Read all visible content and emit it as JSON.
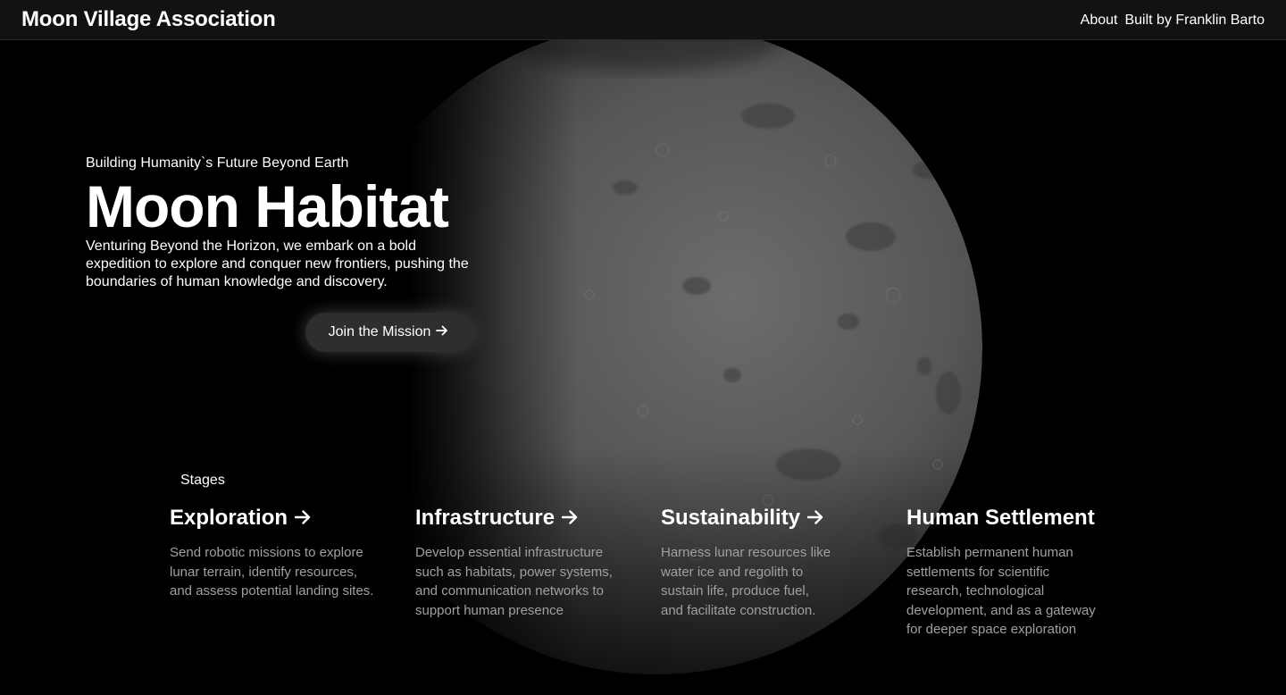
{
  "navbar": {
    "brand": "Moon Village Association",
    "links": [
      {
        "label": "About"
      },
      {
        "label": "Built by Franklin Barto"
      }
    ]
  },
  "hero": {
    "kicker": "Building Humanity`s Future Beyond Earth",
    "title": "Moon Habitat",
    "body": "Venturing Beyond the Horizon, we embark on a bold expedition to explore and conquer new frontiers, pushing the boundaries of human knowledge and discovery.",
    "cta_label": "Join the Mission"
  },
  "stages": {
    "label": "Stages",
    "items": [
      {
        "title": "Exploration",
        "has_arrow": true,
        "desc": "Send robotic missions to explore lunar terrain, identify resources, and assess potential landing sites."
      },
      {
        "title": "Infrastructure",
        "has_arrow": true,
        "desc": "Develop essential infrastructure such as habitats, power systems, and communication networks to support human presence"
      },
      {
        "title": "Sustainability",
        "has_arrow": true,
        "desc": "Harness lunar resources like water ice and regolith to sustain life, produce fuel, and facilitate construction."
      },
      {
        "title": "Human Settlement",
        "has_arrow": false,
        "desc": "Establish permanent human settlements for scientific research, technological development, and as a gateway for deeper space exploration"
      }
    ]
  },
  "icons": {
    "arrow": "arrow-right-icon"
  },
  "colors": {
    "background": "#000000",
    "navbar": "#121212",
    "button": "#2e2e2e",
    "muted_text": "#a0a0a0",
    "moon_light": "#6e6e6e",
    "moon_dark": "#3a3a3a"
  }
}
